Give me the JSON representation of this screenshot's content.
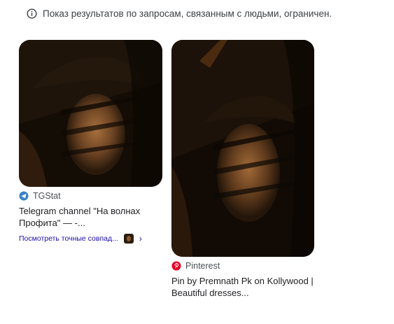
{
  "notice": {
    "icon": "info-icon",
    "text": "Показ результатов по запросам, связанным с людьми, ограничен."
  },
  "results": [
    {
      "source": "TGStat",
      "source_icon": "tgstat-icon",
      "title": "Telegram channel \"На волнах Профита\" — -...",
      "similar_link": "Посмотреть точные совпад..."
    },
    {
      "source": "Pinterest",
      "source_icon": "pinterest-icon",
      "title": "Pin by Premnath Pk on Kollywood | Beautiful dresses..."
    }
  ],
  "colors": {
    "link": "#1a0dab",
    "pinterest": "#e60023",
    "tgstat": "#3b82c4"
  }
}
